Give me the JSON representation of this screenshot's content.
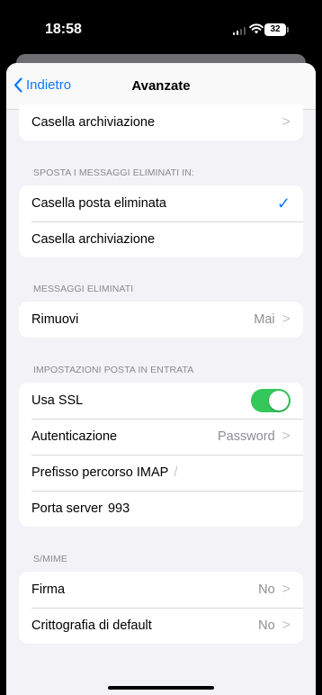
{
  "status": {
    "time": "18:58",
    "battery": "32"
  },
  "nav": {
    "back_label": "Indietro",
    "title": "Avanzate"
  },
  "archive_top": {
    "label": "Casella archiviazione"
  },
  "move_deleted": {
    "header": "SPOSTA I MESSAGGI ELIMINATI IN:",
    "items": [
      {
        "label": "Casella posta eliminata",
        "selected": true
      },
      {
        "label": "Casella archiviazione",
        "selected": false
      }
    ]
  },
  "deleted_messages": {
    "header": "MESSAGGI ELIMINATI",
    "remove_label": "Rimuovi",
    "remove_value": "Mai"
  },
  "incoming": {
    "header": "IMPOSTAZIONI POSTA IN ENTRATA",
    "ssl_label": "Usa SSL",
    "ssl_on": true,
    "auth_label": "Autenticazione",
    "auth_value": "Password",
    "imap_prefix_label": "Prefisso percorso IMAP",
    "imap_prefix_value": "/",
    "port_label": "Porta server",
    "port_value": "993"
  },
  "smime": {
    "header": "S/MIME",
    "sign_label": "Firma",
    "sign_value": "No",
    "encrypt_label": "Crittografia di default",
    "encrypt_value": "No"
  },
  "colors": {
    "accent": "#0a7aff",
    "toggle_on": "#34c759"
  }
}
